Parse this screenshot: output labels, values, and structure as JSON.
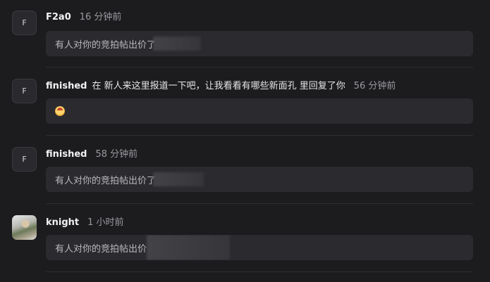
{
  "notifications": [
    {
      "avatar_letter": "F",
      "user": "F2a0",
      "context": "",
      "time": "16 分钟前",
      "message": "有人对你的竞拍帖出价了"
    },
    {
      "avatar_letter": "F",
      "user": "finished",
      "context": "在 新人来这里报道一下吧，让我看看有哪些新面孔 里回复了你",
      "time": "56 分钟前",
      "message": "",
      "emoji": "face-emoji"
    },
    {
      "avatar_letter": "F",
      "user": "finished",
      "context": "",
      "time": "58 分钟前",
      "message": "有人对你的竞拍帖出价了"
    },
    {
      "avatar_letter": "",
      "user": "knight",
      "context": "",
      "time": "1 小时前",
      "message": "有人对你的竞拍帖出价"
    }
  ]
}
